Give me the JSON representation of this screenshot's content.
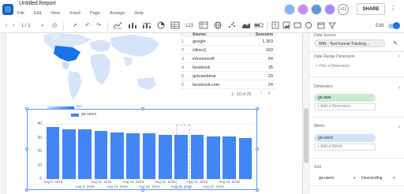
{
  "header": {
    "title": "Untitled Report",
    "menu": [
      "File",
      "Edit",
      "View",
      "Insert",
      "Page",
      "Arrange",
      "Help"
    ],
    "avatar_overflow": "+21",
    "share_label": "SHARE",
    "more_icon": "more-vert-icon"
  },
  "toolbar": {
    "page_indicator": "1 / 1",
    "edit_label": "Edit",
    "icons": [
      "back-icon",
      "forward-icon",
      "page-dropdown-icon",
      "clock-icon",
      "select-cursor-icon",
      "undo-icon",
      "redo-icon",
      "timeseries-icon",
      "bar-chart-icon",
      "combo-chart-icon",
      "pie-chart-icon",
      "table-icon",
      "scorecard-icon",
      "pivot-icon",
      "globe-icon",
      "scatter-icon",
      "area-chart-icon",
      "bullet-icon",
      "text-icon",
      "image-icon",
      "rectangle-icon",
      "circle-icon",
      "date-range-icon",
      "filter-icon"
    ]
  },
  "geo_map": {
    "legend_max": "345"
  },
  "table": {
    "headers": {
      "source": "Source",
      "sessions": "Sessions"
    },
    "rows": [
      {
        "idx": "1.",
        "source": "google",
        "value": "1,303"
      },
      {
        "idx": "2.",
        "source": "(direct)",
        "value": "163"
      },
      {
        "idx": "3.",
        "source": "infusionsoft",
        "value": "64"
      },
      {
        "idx": "4.",
        "source": "facebook",
        "value": "35"
      },
      {
        "idx": "5.",
        "source": "gotowebinar",
        "value": "29"
      },
      {
        "idx": "6.",
        "source": "facebook.com",
        "value": "24"
      }
    ],
    "pagination": "1 - 10 of 25"
  },
  "chart_data": {
    "type": "bar",
    "series": [
      {
        "name": "ga:users",
        "values": [
          38,
          36,
          36,
          35,
          34,
          33,
          33,
          32,
          32,
          32,
          31,
          31,
          30
        ]
      }
    ],
    "x": [
      "Aug 5, 2016",
      "Aug 4, 2016",
      "Aug 11, 2016",
      "Aug 10, 2016",
      "Aug 18, 2016",
      "Aug 25, 2016",
      "Aug 31, 2016",
      "Aug 30, 2016",
      "Aug 11, 2016",
      "Aug 30, 2016",
      "Aug 17, 2016",
      "Aug 17, 2016",
      "Aug 17, 2016"
    ],
    "x_tick_labels_top": [
      "Aug 5, 2016",
      "Aug 11, 2016",
      "Aug 18, 2016",
      "Aug 31, 2016",
      "Aug 11, 2016",
      "Aug 24, 2016"
    ],
    "x_tick_labels_bottom": [
      "Aug 4, 2016",
      "Aug 10, 2016",
      "Aug 25, 2016",
      "Aug 30, 2016",
      "Aug 17, 2016"
    ],
    "y_ticks": [
      "0",
      "10",
      "20",
      "30",
      "40"
    ],
    "ylim": [
      0,
      40
    ],
    "legend": "top-left",
    "grid": true
  },
  "panel": {
    "datasource_label": "Data Source",
    "datasource_value": "WW - Test Funnel Tracking ...",
    "date_range_label": "Date Range Dimension",
    "date_range_add": "+ Pick a Dimension",
    "dimension_label": "Dimension",
    "dimension_value": "ga:date",
    "dimension_add": "+ Add a Dimension",
    "metric_label": "Metric",
    "metric_value": "ga:users",
    "metric_add": "+ Add a Metric",
    "sort_label": "Sort",
    "sort_field": "ga:users",
    "sort_order": "Descending"
  }
}
